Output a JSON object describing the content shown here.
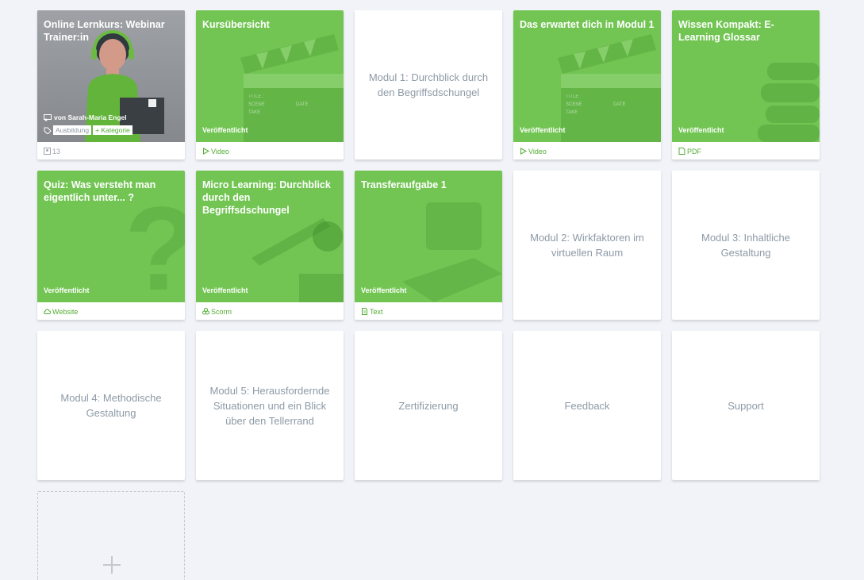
{
  "cards": [
    {
      "title": "Online Lernkurs: Webinar Trainer:in",
      "author": "von Sarah-Maria Engel",
      "tags": [
        "Ausbildung",
        "+ Kategorie"
      ],
      "footer": "13",
      "footer_icon": "participants-icon"
    },
    {
      "title": "Kursübersicht",
      "status": "Veröffentlicht",
      "footer": "Video",
      "footer_icon": "play-icon"
    },
    {
      "title": "Modul 1: Durchblick durch den Begriffsdschungel"
    },
    {
      "title": "Das erwartet dich in Modul 1",
      "status": "Veröffentlicht",
      "footer": "Video",
      "footer_icon": "play-icon"
    },
    {
      "title": "Wissen Kompakt: E-Learning Glossar",
      "status": "Veröffentlicht",
      "footer": "PDF",
      "footer_icon": "pdf-icon"
    },
    {
      "title": "Quiz: Was versteht man eigentlich unter... ?",
      "status": "Veröffentlicht",
      "footer": "Website",
      "footer_icon": "cloud-icon"
    },
    {
      "title": "Micro Learning: Durchblick durch den Begriffsdschungel",
      "status": "Veröffentlicht",
      "footer": "Scorm",
      "footer_icon": "scorm-icon"
    },
    {
      "title": "Transferaufgabe 1",
      "status": "Veröffentlicht",
      "footer": "Text",
      "footer_icon": "text-icon"
    },
    {
      "title": "Modul 2: Wirkfaktoren im virtuellen Raum"
    },
    {
      "title": "Modul 3: Inhaltliche Gestaltung"
    },
    {
      "title": "Modul 4: Methodische Gestaltung"
    },
    {
      "title": "Modul 5: Herausfordernde Situationen und ein Blick über den Tellerrand"
    },
    {
      "title": "Zertifizierung"
    },
    {
      "title": "Feedback"
    },
    {
      "title": "Support"
    }
  ],
  "colors": {
    "accent": "#72c553",
    "text_muted": "#8d9aa6",
    "background": "#f1f3f8"
  }
}
